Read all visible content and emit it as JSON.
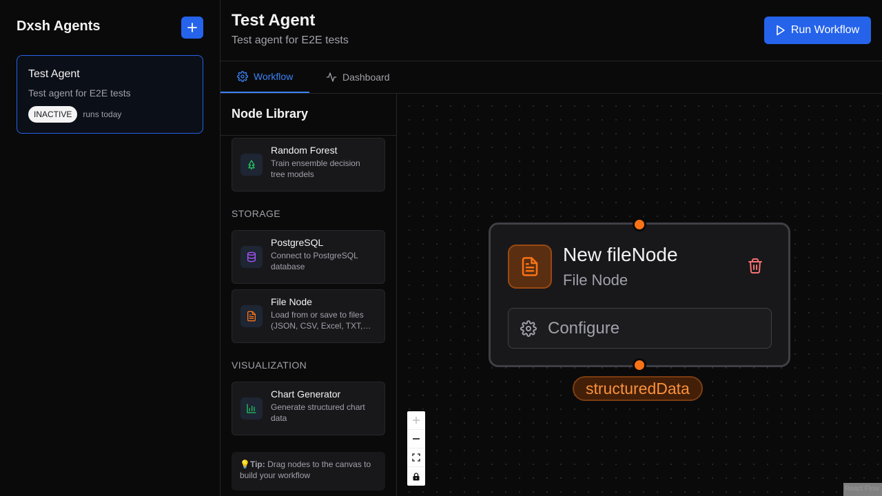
{
  "sidebar": {
    "title": "Dxsh Agents",
    "add_icon": "plus-icon",
    "agent": {
      "name": "Test Agent",
      "description": "Test agent for E2E tests",
      "status": "INACTIVE",
      "runs": "runs today"
    }
  },
  "header": {
    "title": "Test Agent",
    "subtitle": "Test agent for E2E tests",
    "run_label": "Run Workflow",
    "run_icon": "play-icon"
  },
  "tabs": [
    {
      "label": "Workflow",
      "icon": "gear-icon",
      "active": true
    },
    {
      "label": "Dashboard",
      "icon": "activity-icon",
      "active": false
    }
  ],
  "library": {
    "title": "Node Library",
    "items": [
      {
        "name": "Random Forest",
        "description": "Train ensemble decision tree models",
        "icon": "tree-icon",
        "color": "#22c55e"
      },
      {
        "name": "PostgreSQL",
        "description": "Connect to PostgreSQL database",
        "icon": "database-icon",
        "color": "#a855f7"
      },
      {
        "name": "File Node",
        "description": "Load from or save to files (JSON, CSV, Excel, TXT,…",
        "icon": "file-icon",
        "color": "#f97316"
      },
      {
        "name": "Chart Generator",
        "description": "Generate structured chart data",
        "icon": "bar-chart-icon",
        "color": "#22c55e"
      }
    ],
    "sections": [
      "STORAGE",
      "VISUALIZATION"
    ],
    "tip_label": "Tip:",
    "tip_text": "Drag nodes to the canvas to build your workflow"
  },
  "canvas": {
    "node": {
      "title": "New fileNode",
      "type": "File Node",
      "icon": "file-icon",
      "delete_icon": "trash-icon",
      "configure_label": "Configure",
      "output_label": "structuredData"
    },
    "controls": [
      "zoom-in-icon",
      "zoom-out-icon",
      "fit-view-icon",
      "lock-icon"
    ],
    "attribution": "React Flow"
  },
  "colors": {
    "accent": "#2563eb",
    "node_accent": "#f97316",
    "delete": "#f87171"
  }
}
